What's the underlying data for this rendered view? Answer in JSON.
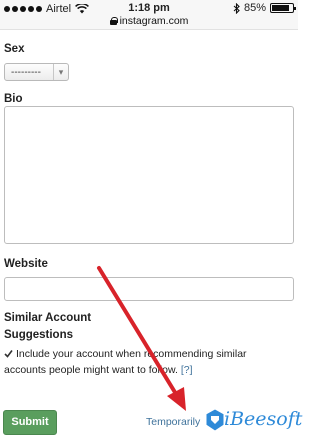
{
  "status_bar": {
    "carrier": "Airtel",
    "time": "1:18 pm",
    "url": "instagram.com",
    "battery": "85%",
    "battery_level": 0.85
  },
  "form": {
    "sex_label": "Sex",
    "sex_value": "---------",
    "bio_label": "Bio",
    "bio_value": "",
    "website_label": "Website",
    "website_value": "",
    "similar_label_line1": "Similar Account",
    "similar_label_line2": "Suggestions",
    "similar_text_line1": "Include your account when recommending similar",
    "similar_text_line2": "accounts people might want to follow.",
    "help_link": "[?]",
    "similar_checked": true
  },
  "actions": {
    "submit_label": "Submit",
    "disable_link": "Temporarily"
  },
  "watermark": {
    "text": "iBeesoft"
  },
  "colors": {
    "submit_bg": "#5a9e5e",
    "link": "#3f729b",
    "arrow": "#d8232a",
    "watermark": "#2e8ad8"
  }
}
